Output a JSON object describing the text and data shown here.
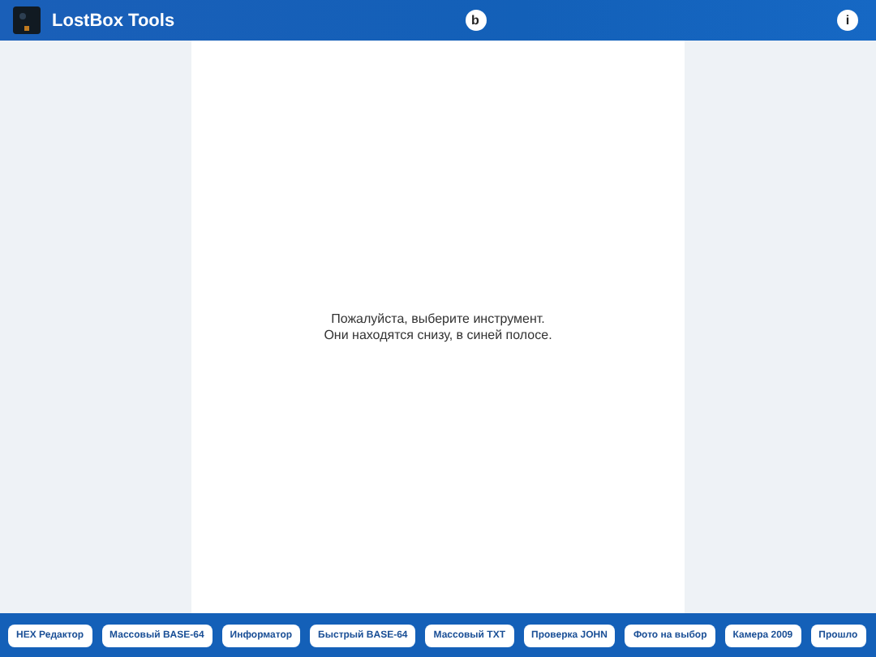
{
  "header": {
    "title": "LostBox Tools",
    "center_button": "b",
    "info_button": "i"
  },
  "message": {
    "lines": [
      "Пожалуйста, выберите инструмент.",
      "Они находятся снизу, в синей полосе."
    ]
  },
  "toolbar": {
    "tools": [
      "HEX Редактор",
      "Массовый BASE-64",
      "Информатор",
      "Быстрый BASE-64",
      "Массовый TXT",
      "Проверка JOHN",
      "Фото на выбор",
      "Камера 2009",
      "Прошло"
    ]
  }
}
